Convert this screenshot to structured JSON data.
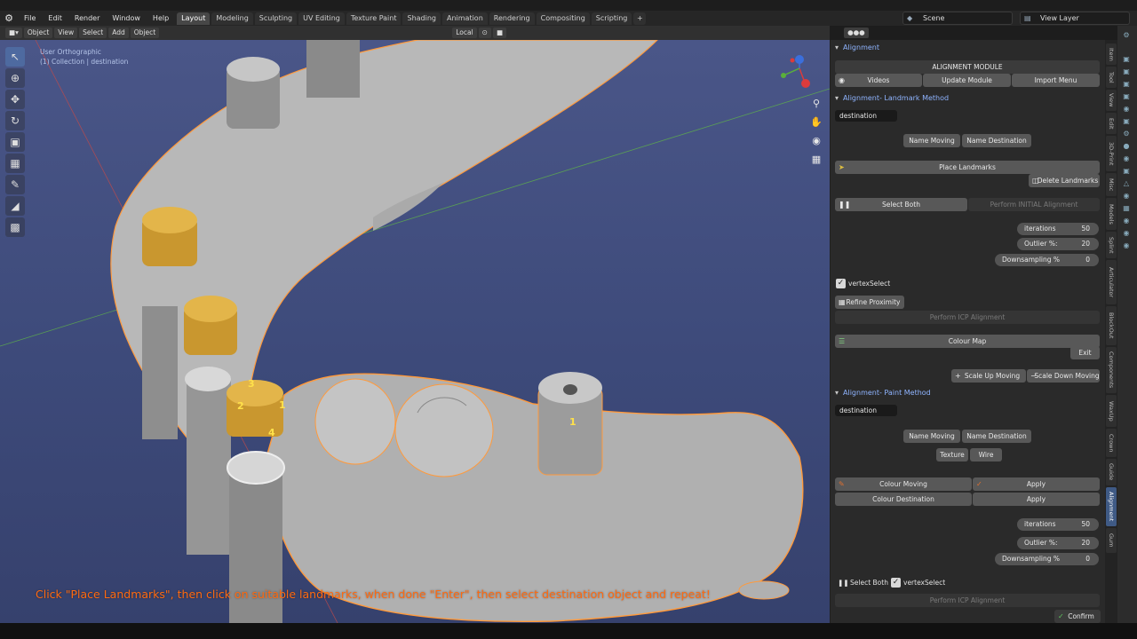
{
  "menu": {
    "items": [
      "File",
      "Edit",
      "Render",
      "Window",
      "Help"
    ],
    "workspaces": [
      "Layout",
      "Modeling",
      "Sculpting",
      "UV Editing",
      "Texture Paint",
      "Shading",
      "Animation",
      "Rendering",
      "Compositing",
      "Scripting"
    ],
    "active_workspace": "Layout",
    "add_tab": "+",
    "scene": "Scene",
    "view_layer": "View Layer"
  },
  "viewport_header": {
    "mode": "Object Mode",
    "view": "View",
    "select": "Select",
    "add": "Add",
    "object": "Object",
    "orientation": "Local"
  },
  "viewport": {
    "view_name": "User Orthographic",
    "collection": "(1) Collection | destination",
    "instruction": "Click \"Place Landmarks\", then click on suitable landmarks, when done \"Enter\", then select destination object and repeat!",
    "landmarks": [
      "3",
      "2",
      "1",
      "4",
      "1"
    ],
    "gizmo_axes": [
      "Z",
      "Y",
      "X"
    ]
  },
  "panel": {
    "alignment": {
      "title": "Alignment",
      "module_label": "ALIGNMENT MODULE",
      "videos": "Videos",
      "update_module": "Update Module",
      "import_menu": "Import Menu"
    },
    "landmark": {
      "title": "Alignment- Landmark Method",
      "destination": "destination",
      "name_moving": "Name Moving",
      "name_destination": "Name Destination",
      "place_landmarks": "Place Landmarks",
      "delete_landmarks": "Delete Landmarks",
      "select_both": "Select Both",
      "perform_initial": "Perform INITIAL Alignment",
      "iterations_label": "iterations",
      "iterations_value": "50",
      "outlier_label": "Outlier %:",
      "outlier_value": "20",
      "downsampling_label": "Downsampling %",
      "downsampling_value": "0",
      "vertex_select": "vertexSelect",
      "refine_proximity": "Refine Proximity",
      "perform_icp": "Perform ICP Alignment",
      "colour_map": "Colour Map",
      "exit": "Exit",
      "scale_up": "Scale Up Moving",
      "scale_down": "Scale Down Moving"
    },
    "paint": {
      "title": "Alignment- Paint Method",
      "destination": "destination",
      "name_moving": "Name Moving",
      "name_destination": "Name Destination",
      "texture": "Texture",
      "wire": "Wire",
      "colour_moving": "Colour Moving",
      "colour_destination": "Colour Destination",
      "apply": "Apply",
      "iterations_label": "iterations",
      "iterations_value": "50",
      "outlier_label": "Outlier %:",
      "outlier_value": "20",
      "downsampling_label": "Downsampling %",
      "downsampling_value": "0",
      "select_both": "Select Both",
      "vertex_select": "vertexSelect",
      "perform_icp": "Perform ICP Alignment",
      "confirm": "Confirm"
    }
  },
  "side_tabs": [
    "Item",
    "Tool",
    "View",
    "Edit",
    "3D-Print",
    "Misc",
    "Models",
    "Splint",
    "Articulator",
    "BlockOut",
    "Components",
    "WaxUp",
    "Crown",
    "Guide",
    "Alignment",
    "Gum"
  ],
  "active_side_tab": "Alignment",
  "colors": {
    "accent": "#4772b3",
    "section_title": "#8fb4ff",
    "instruction": "#ff6a10",
    "selection_outline": "#ff9a3c",
    "implant_gold": "#d4a43a",
    "model_gray": "#b4b4b4"
  }
}
